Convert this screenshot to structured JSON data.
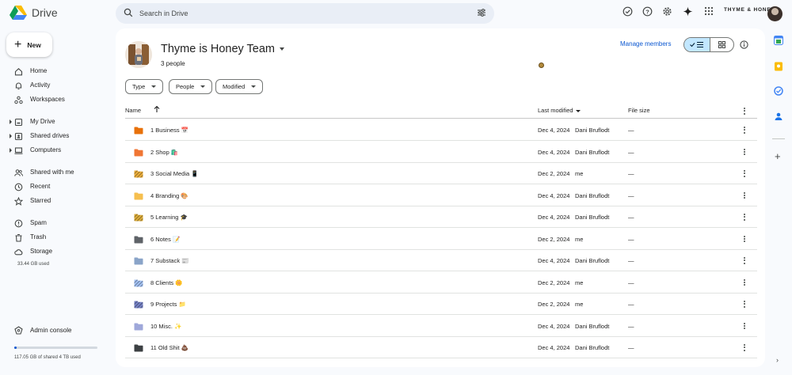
{
  "app": {
    "name": "Drive",
    "brand_chip": "THYME & HONEY"
  },
  "search": {
    "placeholder": "Search in Drive"
  },
  "sidebar": {
    "new_label": "New",
    "items": [
      {
        "label": "Home",
        "icon": "home-icon"
      },
      {
        "label": "Activity",
        "icon": "bell-icon"
      },
      {
        "label": "Workspaces",
        "icon": "workspaces-icon"
      },
      {
        "label": "My Drive",
        "icon": "my-drive-icon"
      },
      {
        "label": "Shared drives",
        "icon": "shared-drives-icon"
      },
      {
        "label": "Computers",
        "icon": "computer-icon"
      },
      {
        "label": "Shared with me",
        "icon": "people-icon"
      },
      {
        "label": "Recent",
        "icon": "clock-icon"
      },
      {
        "label": "Starred",
        "icon": "star-icon"
      },
      {
        "label": "Spam",
        "icon": "spam-icon"
      },
      {
        "label": "Trash",
        "icon": "trash-icon"
      },
      {
        "label": "Storage",
        "icon": "cloud-icon"
      }
    ],
    "storage_used": "33.44 GB used",
    "admin_label": "Admin console",
    "quota_text": "117.05 GB of shared 4 TB used",
    "quota_fraction": 0.03
  },
  "team": {
    "title": "Thyme is Honey Team",
    "people": "3 people",
    "manage_members": "Manage members"
  },
  "filters": [
    "Type",
    "People",
    "Modified"
  ],
  "table": {
    "headers": {
      "name": "Name",
      "last_modified": "Last modified",
      "file_size": "File size"
    },
    "rows": [
      {
        "name": "1 Business",
        "emoji": "📅",
        "date": "Dec 4, 2024",
        "owner": "Dani Bruflodt",
        "size": "—",
        "color": "#e8710a",
        "pattern": false
      },
      {
        "name": "2  Shop",
        "emoji": "🛍️",
        "date": "Dec 4, 2024",
        "owner": "Dani Bruflodt",
        "size": "—",
        "color": "#f07634",
        "pattern": false
      },
      {
        "name": "3 Social Media",
        "emoji": "📱",
        "date": "Dec 2, 2024",
        "owner": "me",
        "size": "—",
        "color": "#f2b33d",
        "pattern": true
      },
      {
        "name": "4 Branding",
        "emoji": "🎨",
        "date": "Dec 4, 2024",
        "owner": "Dani Bruflodt",
        "size": "—",
        "color": "#f6bf4f",
        "pattern": false
      },
      {
        "name": "5 Learning",
        "emoji": "🎓",
        "date": "Dec 4, 2024",
        "owner": "Dani Bruflodt",
        "size": "—",
        "color": "#e3b23c",
        "pattern": true
      },
      {
        "name": "6 Notes",
        "emoji": "📝",
        "date": "Dec 2, 2024",
        "owner": "me",
        "size": "—",
        "color": "#5f6368",
        "pattern": false
      },
      {
        "name": "7 Substack",
        "emoji": "📰",
        "date": "Dec 4, 2024",
        "owner": "Dani Bruflodt",
        "size": "—",
        "color": "#8aa4c8",
        "pattern": false
      },
      {
        "name": "8 Clients",
        "emoji": "🌼",
        "date": "Dec 2, 2024",
        "owner": "me",
        "size": "—",
        "color": "#a8c7fa",
        "pattern": true
      },
      {
        "name": "9 Projects",
        "emoji": "📁",
        "date": "Dec 2, 2024",
        "owner": "me",
        "size": "—",
        "color": "#7986cb",
        "pattern": true
      },
      {
        "name": "10 Misc.",
        "emoji": "✨",
        "date": "Dec 4, 2024",
        "owner": "Dani Bruflodt",
        "size": "—",
        "color": "#9fa8da",
        "pattern": false
      },
      {
        "name": "11 Old Shit",
        "emoji": "💩",
        "date": "Dec 4, 2024",
        "owner": "Dani Bruflodt",
        "size": "—",
        "color": "#3c4043",
        "pattern": false
      }
    ]
  },
  "colors": {
    "accent": "#0b57d0",
    "toggle_active": "#c2e7ff",
    "panel": "#ffffff",
    "background": "#f8fafd"
  }
}
